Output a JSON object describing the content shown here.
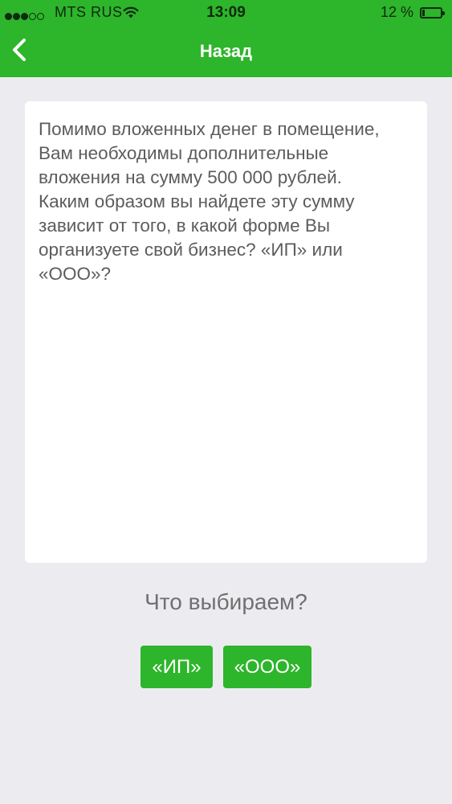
{
  "status_bar": {
    "signal_filled_dots": 3,
    "signal_total_dots": 5,
    "carrier": "MTS RUS",
    "time": "13:09",
    "battery_percent": "12 %",
    "icons": [
      "signal-dots-icon",
      "wifi-icon",
      "battery-icon"
    ]
  },
  "nav": {
    "back_icon": "chevron-left-icon",
    "title": "Назад"
  },
  "card": {
    "text": "Помимо вложенных денег в помещение,\nВам необходимы дополнительные\nвложения на сумму 500 000 рублей.\nКаким образом вы найдете эту сумму\nзависит от того, в какой форме Вы\nорганизуете свой бизнес?  «ИП» или\n«ООО»?"
  },
  "prompt": "Что выбираем?",
  "choices": [
    {
      "label": "«ИП»"
    },
    {
      "label": "«ООО»"
    }
  ],
  "colors": {
    "accent": "#2db52b",
    "background": "#ececf0",
    "card": "#ffffff",
    "text": "#5c5c5c"
  }
}
